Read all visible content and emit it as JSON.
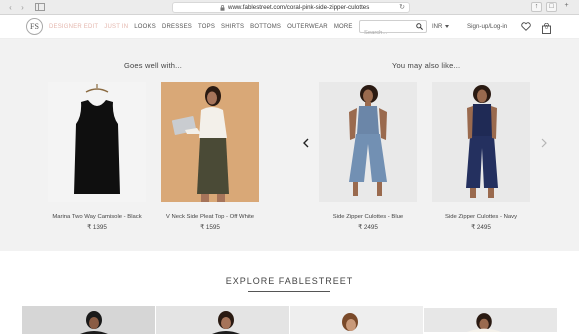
{
  "browser": {
    "url": "www.fablestreet.com/coral-pink-side-zipper-culottes",
    "tabs_icon": "sidebar-icon",
    "share_icon": "share-icon",
    "tabs_overview_icon": "tabs-icon",
    "new_tab_label": "+"
  },
  "header": {
    "logo_text": "FS",
    "nav": [
      {
        "label": "DESIGNER EDIT",
        "accent": true
      },
      {
        "label": "JUST IN",
        "accent": true
      },
      {
        "label": "LOOKS",
        "accent": false
      },
      {
        "label": "DRESSES",
        "accent": false
      },
      {
        "label": "TOPS",
        "accent": false
      },
      {
        "label": "SHIRTS",
        "accent": false
      },
      {
        "label": "BOTTOMS",
        "accent": false
      },
      {
        "label": "OUTERWEAR",
        "accent": false
      },
      {
        "label": "MORE",
        "accent": false
      }
    ],
    "search_placeholder": "Search...",
    "currency": "INR",
    "signup": "Sign-up/Log-in",
    "bag_count": "0"
  },
  "goes_well": {
    "title": "Goes well with...",
    "products": [
      {
        "name": "Marina Two Way Camisole - Black",
        "price": "₹ 1395"
      },
      {
        "name": "V Neck Side Pleat Top - Off White",
        "price": "₹ 1595"
      }
    ]
  },
  "may_like": {
    "title": "You may also like...",
    "products": [
      {
        "name": "Side Zipper Culottes - Blue",
        "price": "₹ 2495"
      },
      {
        "name": "Side Zipper Culottes - Navy",
        "price": "₹ 2495"
      }
    ]
  },
  "explore": {
    "title": "EXPLORE FABLESTREET"
  },
  "colors": {
    "accent": "#e4b7ae",
    "band": "#f2f2f2",
    "text": "#444444"
  }
}
